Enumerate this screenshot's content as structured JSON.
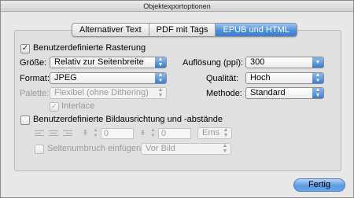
{
  "window": {
    "title": "Objektexportoptionen"
  },
  "tabs": [
    {
      "label": "Alternativer Text"
    },
    {
      "label": "PDF mit Tags"
    },
    {
      "label": "EPUB und HTML"
    }
  ],
  "active_tab": "EPUB und HTML",
  "rasterung": {
    "checkbox_label": "Benutzerdefinierte Rasterung",
    "checked": true,
    "groesse_label": "Größe:",
    "groesse_value": "Relativ zur Seitenbreite",
    "format_label": "Format:",
    "format_value": "JPEG",
    "palette_label": "Palette:",
    "palette_value": "Flexibel (ohne Dithering)",
    "interlace_label": "Interlace",
    "aufloesung_label": "Auflösung (ppi):",
    "aufloesung_value": "300",
    "qualitaet_label": "Qualität:",
    "qualitaet_value": "Hoch",
    "methode_label": "Methode:",
    "methode_value": "Standard"
  },
  "ausrichtung": {
    "checkbox_label": "Benutzerdefinierte Bildausrichtung und -abstände",
    "checked": false,
    "space_before_value": "0",
    "space_after_value": "0",
    "unit_value": "Ems",
    "pagebreak_label": "Seitenumbruch einfügen:",
    "pagebreak_value": "Vor Bild"
  },
  "buttons": {
    "ok_label": "Fertig"
  },
  "colors": {
    "accent": "#3a7ed0",
    "disabled_text": "#9a9a9a"
  }
}
